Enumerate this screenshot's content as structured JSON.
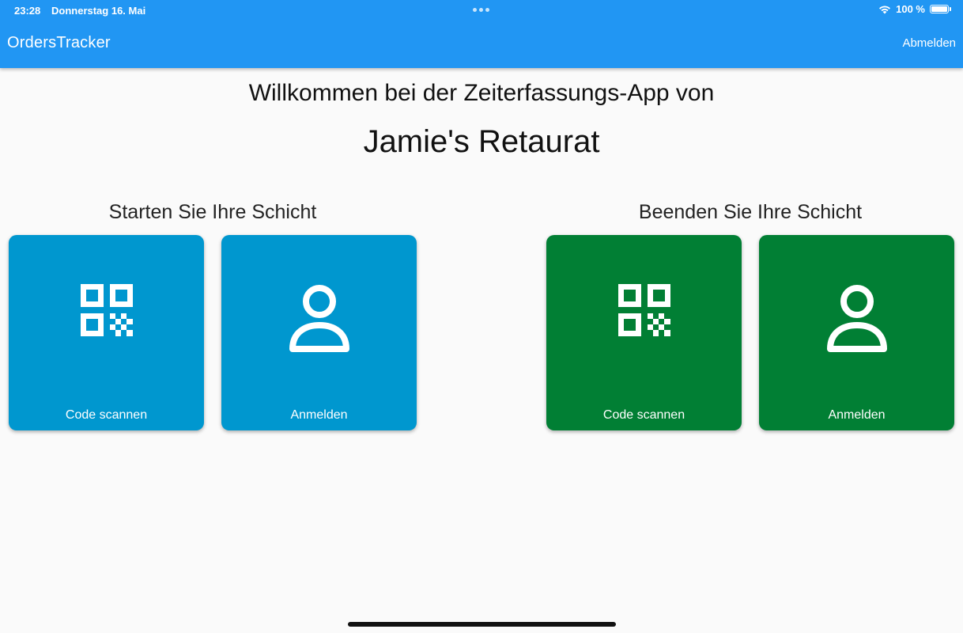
{
  "status_bar": {
    "time": "23:28",
    "date": "Donnerstag 16. Mai",
    "battery": "100 %",
    "battery_level": 1.0
  },
  "app_bar": {
    "title": "OrdersTracker",
    "logout_label": "Abmelden"
  },
  "main": {
    "welcome": "Willkommen bei der Zeiterfassungs-App von",
    "restaurant_name": "Jamie's Retaurat",
    "start_section": {
      "title": "Starten Sie Ihre Schicht",
      "scan_label": "Code scannen",
      "login_label": "Anmelden"
    },
    "end_section": {
      "title": "Beenden Sie Ihre Schicht",
      "scan_label": "Code scannen",
      "login_label": "Anmelden"
    }
  },
  "icons": [
    "wifi-icon",
    "battery-icon",
    "qr-code-icon",
    "person-icon"
  ],
  "colors": {
    "app_bar": "#2196f3",
    "start_tile": "#0097cf",
    "end_tile": "#017f34",
    "background": "#fafafa"
  }
}
